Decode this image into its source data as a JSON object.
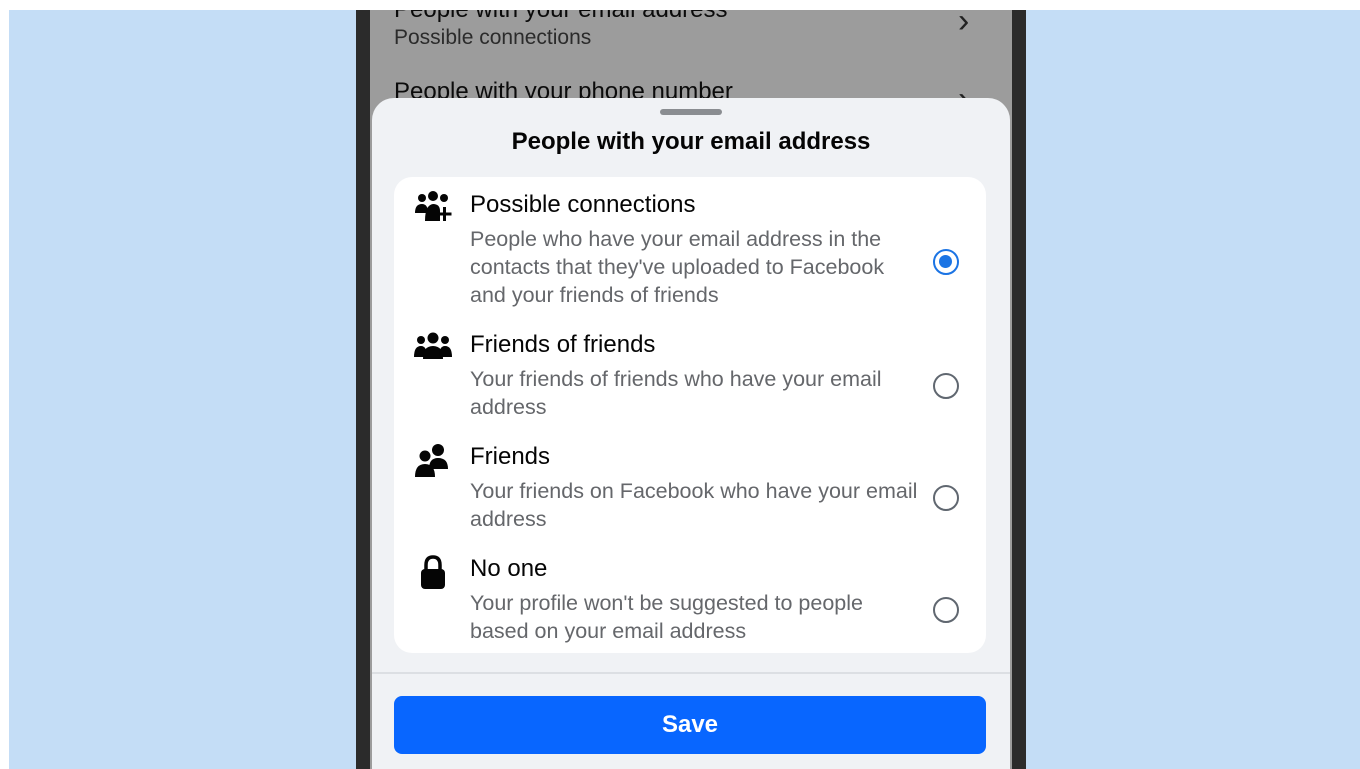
{
  "background_screen": {
    "row1_title": "People with your email address",
    "row1_subtitle": "Possible connections",
    "row2_title": "People with your phone number",
    "chevron": "›"
  },
  "sheet": {
    "title": "People with your email address",
    "options": [
      {
        "icon": "people-plus-icon",
        "title": "Possible connections",
        "description": "People who have your email address in the contacts that they've uploaded to Facebook and your friends of friends",
        "selected": true
      },
      {
        "icon": "group-icon",
        "title": "Friends of friends",
        "description": "Your friends of friends who have your email address",
        "selected": false
      },
      {
        "icon": "two-people-icon",
        "title": "Friends",
        "description": "Your friends on Facebook who have your email address",
        "selected": false
      },
      {
        "icon": "lock-icon",
        "title": "No one",
        "description": "Your profile won't be suggested to people based on your email address",
        "selected": false
      }
    ],
    "save_label": "Save"
  },
  "colors": {
    "accent": "#0866ff",
    "radio_selected": "#1b74e4",
    "page_background": "#c4ddf6"
  }
}
